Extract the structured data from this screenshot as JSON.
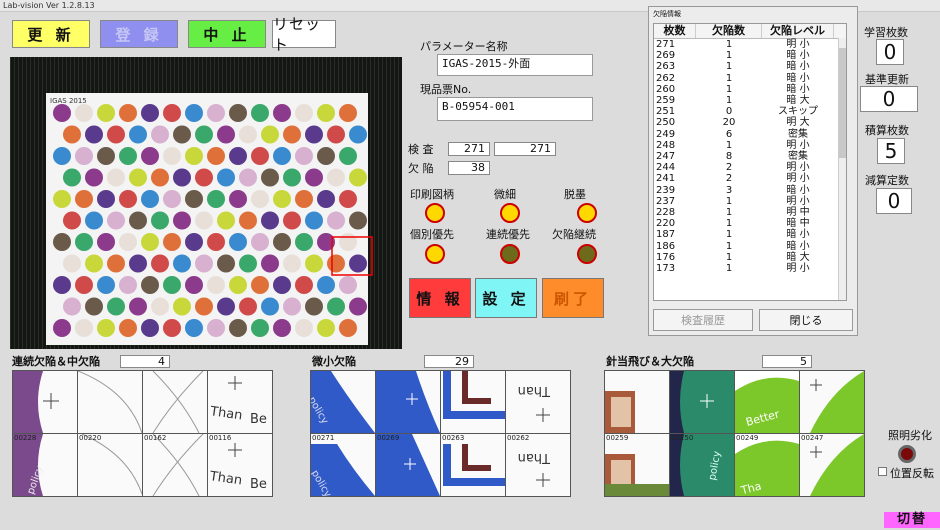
{
  "window": {
    "title": "Lab-vision  Ver 1.2.8.13"
  },
  "toolbar": {
    "update": "更 新",
    "register": "登 録",
    "stop": "中 止",
    "reset": "リセット"
  },
  "sheet": {
    "title": "IGAS 2015"
  },
  "params": {
    "name_label": "パラメーター名称",
    "name_value": "IGAS-2015-外面",
    "ticket_label": "現品票No.",
    "ticket_value": "B-05954-001",
    "inspect_label": "検 査",
    "inspect_value1": "271",
    "inspect_value2": "271",
    "defect_label": "欠 陥",
    "defect_value": "38"
  },
  "indicators": [
    {
      "label": "印刷図柄",
      "state": "on"
    },
    {
      "label": "微細",
      "state": "on"
    },
    {
      "label": "脱墨",
      "state": "on"
    },
    {
      "label": "個別優先",
      "state": "on"
    },
    {
      "label": "連続優先",
      "state": "off"
    },
    {
      "label": "欠陥継続",
      "state": "off"
    }
  ],
  "actions": {
    "info": "情 報",
    "settings": "設 定",
    "done": "刷了"
  },
  "history": {
    "title": "欠陥情報",
    "headers": [
      "枚数",
      "欠陥数",
      "欠陥レベル"
    ],
    "rows": [
      [
        "271",
        "1",
        "明 小"
      ],
      [
        "269",
        "1",
        "暗 小"
      ],
      [
        "263",
        "1",
        "暗 小"
      ],
      [
        "262",
        "1",
        "暗 小"
      ],
      [
        "260",
        "1",
        "暗 小"
      ],
      [
        "259",
        "1",
        "暗 大"
      ],
      [
        "251",
        "0",
        "スキップ"
      ],
      [
        "250",
        "20",
        "明 大"
      ],
      [
        "249",
        "6",
        "密集"
      ],
      [
        "248",
        "1",
        "明 小"
      ],
      [
        "247",
        "8",
        "密集"
      ],
      [
        "244",
        "2",
        "明 小"
      ],
      [
        "241",
        "2",
        "明 小"
      ],
      [
        "239",
        "3",
        "暗 小"
      ],
      [
        "237",
        "1",
        "明 小"
      ],
      [
        "228",
        "1",
        "明 中"
      ],
      [
        "220",
        "1",
        "暗 中"
      ],
      [
        "187",
        "1",
        "暗 小"
      ],
      [
        "186",
        "1",
        "暗 小"
      ],
      [
        "176",
        "1",
        "暗 大"
      ],
      [
        "173",
        "1",
        "明 小"
      ]
    ],
    "history_button": "検査履歴",
    "close_button": "閉じる"
  },
  "side": {
    "learn_label": "学習枚数",
    "learn_value": "0",
    "base_label": "基準更新",
    "base_value": "0",
    "accum_label": "積算枚数",
    "accum_value": "5",
    "sub_label": "減算定数",
    "sub_value": "0",
    "light_label": "照明劣化",
    "flip_label": "位置反転",
    "switch_button": "切替"
  },
  "groups": [
    {
      "label": "連続欠陥＆中欠陥",
      "count": "4",
      "ids": [
        "00228",
        "00220",
        "00162",
        "00116"
      ]
    },
    {
      "label": "微小欠陥",
      "count": "29",
      "ids": [
        "00271",
        "00269",
        "00263",
        "00262"
      ]
    },
    {
      "label": "針当飛び＆大欠陥",
      "count": "5",
      "ids": [
        "00259",
        "00250",
        "00249",
        "00247"
      ]
    }
  ],
  "thumb_text": {
    "than": "Than",
    "be": "Be",
    "policy": "policy",
    "better": "Better",
    "tha": "Tha"
  },
  "colors": {
    "update": "#ffff66",
    "register": "#8f8ff0",
    "stop": "#66ee44",
    "info": "#ff3b3b",
    "settings": "#7ff5f5",
    "done": "#ff8c2a",
    "switch": "#ff66ff"
  }
}
